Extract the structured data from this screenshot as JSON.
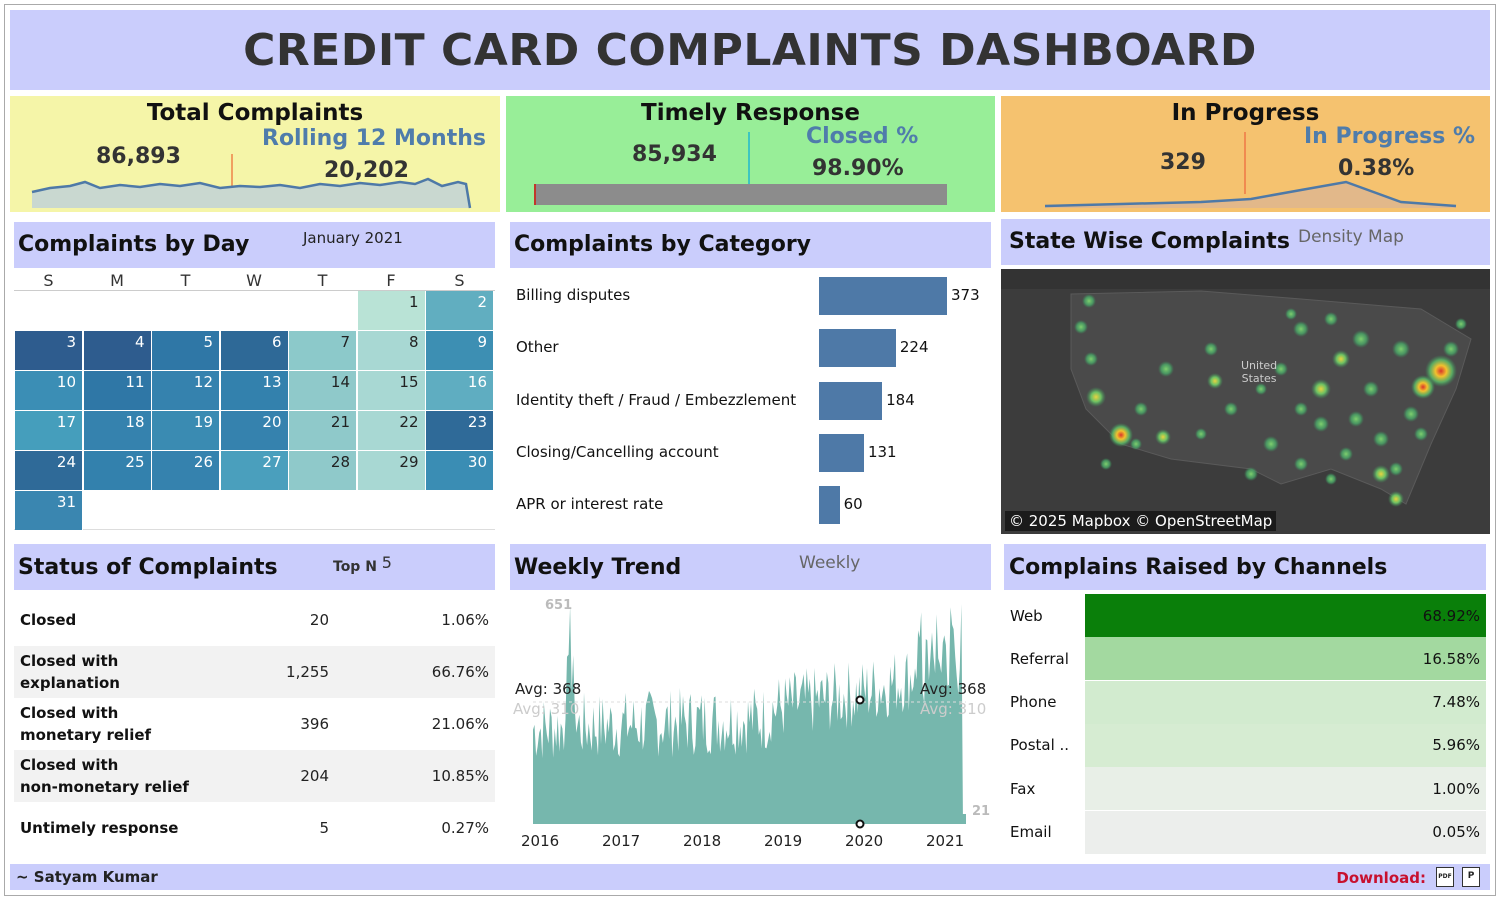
{
  "title": "CREDIT CARD COMPLAINTS DASHBOARD",
  "kpis": {
    "total": {
      "title": "Total Complaints",
      "value": "86,893",
      "sub_label": "Rolling 12 Months",
      "sub_value": "20,202",
      "color": "#f5f5a8"
    },
    "timely": {
      "title": "Timely Response",
      "value": "85,934",
      "sub_label": "Closed %",
      "sub_value": "98.90%",
      "color": "#98ee98"
    },
    "progress": {
      "title": "In Progress",
      "value": "329",
      "sub_label": "In Progress %",
      "sub_value": "0.38%",
      "color": "#f5c26f"
    }
  },
  "calendar": {
    "title": "Complaints by Day",
    "month": "January 2021",
    "weekdays": [
      "S",
      "M",
      "T",
      "W",
      "T",
      "F",
      "S"
    ],
    "days": [
      {
        "day": "1",
        "color": "#b9e3d6"
      },
      {
        "day": "2",
        "color": "#61aec0"
      },
      {
        "day": "3",
        "color": "#2e5c8e"
      },
      {
        "day": "4",
        "color": "#2e5c8e"
      },
      {
        "day": "5",
        "color": "#2f77a6"
      },
      {
        "day": "6",
        "color": "#2e6997"
      },
      {
        "day": "7",
        "color": "#8cc9ca"
      },
      {
        "day": "8",
        "color": "#a8d8d3"
      },
      {
        "day": "9",
        "color": "#3d8fb3"
      },
      {
        "day": "10",
        "color": "#3b8eb5"
      },
      {
        "day": "11",
        "color": "#2f77a6"
      },
      {
        "day": "12",
        "color": "#3582ae"
      },
      {
        "day": "13",
        "color": "#3381ad"
      },
      {
        "day": "14",
        "color": "#8fc9ca"
      },
      {
        "day": "15",
        "color": "#a8d8d3"
      },
      {
        "day": "16",
        "color": "#5fadc1"
      },
      {
        "day": "17",
        "color": "#459ebc"
      },
      {
        "day": "18",
        "color": "#3582ae"
      },
      {
        "day": "19",
        "color": "#3a8bb2"
      },
      {
        "day": "20",
        "color": "#3582ae"
      },
      {
        "day": "21",
        "color": "#8fc9ca"
      },
      {
        "day": "22",
        "color": "#a8d8d3"
      },
      {
        "day": "23",
        "color": "#2f6a98"
      },
      {
        "day": "24",
        "color": "#2f6a98"
      },
      {
        "day": "25",
        "color": "#3381ad"
      },
      {
        "day": "26",
        "color": "#3582ae"
      },
      {
        "day": "27",
        "color": "#4a9fbd"
      },
      {
        "day": "28",
        "color": "#8fc9ca"
      },
      {
        "day": "29",
        "color": "#a8d8d3"
      },
      {
        "day": "30",
        "color": "#3a8db4"
      },
      {
        "day": "31",
        "color": "#3a86b0"
      }
    ]
  },
  "category": {
    "title": "Complaints by Category",
    "items": [
      {
        "label": "Billing disputes",
        "value": 373
      },
      {
        "label": "Other",
        "value": 224
      },
      {
        "label": "Identity theft / Fraud / Embezzlement",
        "value": 184
      },
      {
        "label": "Closing/Cancelling account",
        "value": 131
      },
      {
        "label": "APR or interest rate",
        "value": 60
      }
    ]
  },
  "state": {
    "title": "State Wise Complaints",
    "note": "Density Map",
    "country_label": "United\nStates",
    "credit": "© 2025 Mapbox © OpenStreetMap"
  },
  "status": {
    "title": "Status of Complaints",
    "topn_label": "Top N",
    "topn_value": "5",
    "rows": [
      {
        "name": "Closed",
        "count": "20",
        "pct": "1.06%"
      },
      {
        "name": "Closed with\nexplanation",
        "count": "1,255",
        "pct": "66.76%"
      },
      {
        "name": "Closed with\nmonetary relief",
        "count": "396",
        "pct": "21.06%"
      },
      {
        "name": "Closed with\nnon-monetary relief",
        "count": "204",
        "pct": "10.85%"
      },
      {
        "name": "Untimely response",
        "count": "5",
        "pct": "0.27%"
      }
    ]
  },
  "weekly": {
    "title": "Weekly Trend",
    "note": "Weekly",
    "avg_left": "Avg: 368",
    "avg_left_ghost": "Avg: 310",
    "avg_right": "Avg: 368",
    "avg_right_ghost": "Avg: 310",
    "max_label": "651",
    "min_label": "21",
    "years": [
      "2016",
      "2017",
      "2018",
      "2019",
      "2020",
      "2021"
    ]
  },
  "channels": {
    "title": "Complains Raised by Channels",
    "rows": [
      {
        "name": "Web",
        "pct": "68.92%",
        "color": "#0a7f0a"
      },
      {
        "name": "Referral",
        "pct": "16.58%",
        "color": "#a3d9a0"
      },
      {
        "name": "Phone",
        "pct": "7.48%",
        "color": "#d2ebcf"
      },
      {
        "name": "Postal ..",
        "pct": "5.96%",
        "color": "#d6ecd2"
      },
      {
        "name": "Fax",
        "pct": "1.00%",
        "color": "#e8efe7"
      },
      {
        "name": "Email",
        "pct": "0.05%",
        "color": "#eceeec"
      }
    ]
  },
  "footer": {
    "author": "~ Satyam Kumar",
    "download_label": "Download:",
    "pdf_icon_label": "PDF",
    "ppt_icon_label": "P"
  },
  "chart_data": [
    {
      "type": "bar",
      "title": "Complaints by Category",
      "categories": [
        "Billing disputes",
        "Other",
        "Identity theft / Fraud / Embezzlement",
        "Closing/Cancelling account",
        "APR or interest rate"
      ],
      "values": [
        373,
        224,
        184,
        131,
        60
      ]
    },
    {
      "type": "area",
      "title": "Weekly Trend",
      "x": [
        "2016",
        "2017",
        "2018",
        "2019",
        "2020",
        "2021"
      ],
      "annotations": [
        "Avg: 368",
        "651",
        "21"
      ]
    }
  ]
}
